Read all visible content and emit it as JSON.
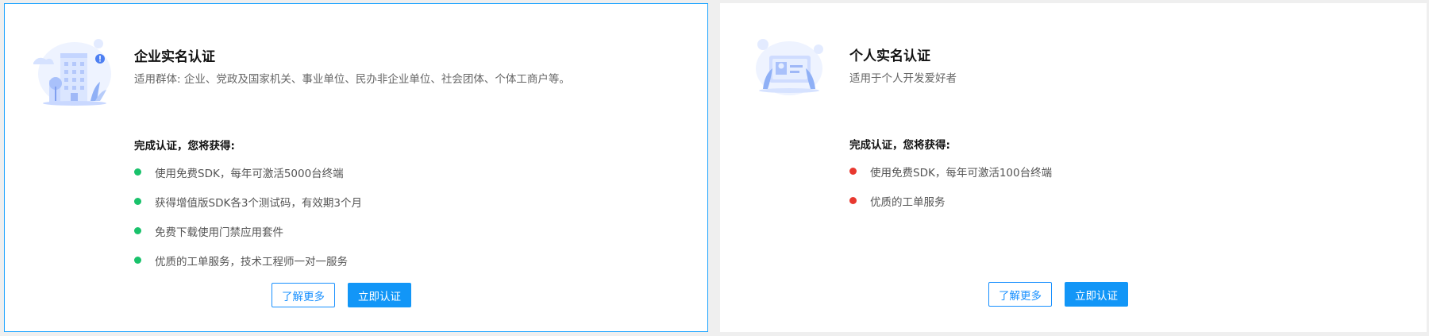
{
  "colors": {
    "accent": "#1890ff",
    "green_dot": "#19c26b",
    "red_dot": "#e8382f",
    "selected_border": "#1aa3ff"
  },
  "enterprise": {
    "icon": "office-building-illustration",
    "title": "企业实名认证",
    "description": "适用群体: 企业、党政及国家机关、事业单位、民办非企业单位、社会团体、个体工商户等。",
    "benefits_title": "完成认证，您将获得:",
    "benefits": [
      "使用免费SDK，每年可激活5000台终端",
      "获得增值版SDK各3个测试码，有效期3个月",
      "免费下载使用门禁应用套件",
      "优质的工单服务，技术工程师一对一服务"
    ],
    "learn_more_label": "了解更多",
    "verify_label": "立即认证"
  },
  "personal": {
    "icon": "id-card-illustration",
    "title": "个人实名认证",
    "description": "适用于个人开发爱好者",
    "benefits_title": "完成认证，您将获得:",
    "benefits": [
      "使用免费SDK，每年可激活100台终端",
      "优质的工单服务"
    ],
    "learn_more_label": "了解更多",
    "verify_label": "立即认证"
  }
}
